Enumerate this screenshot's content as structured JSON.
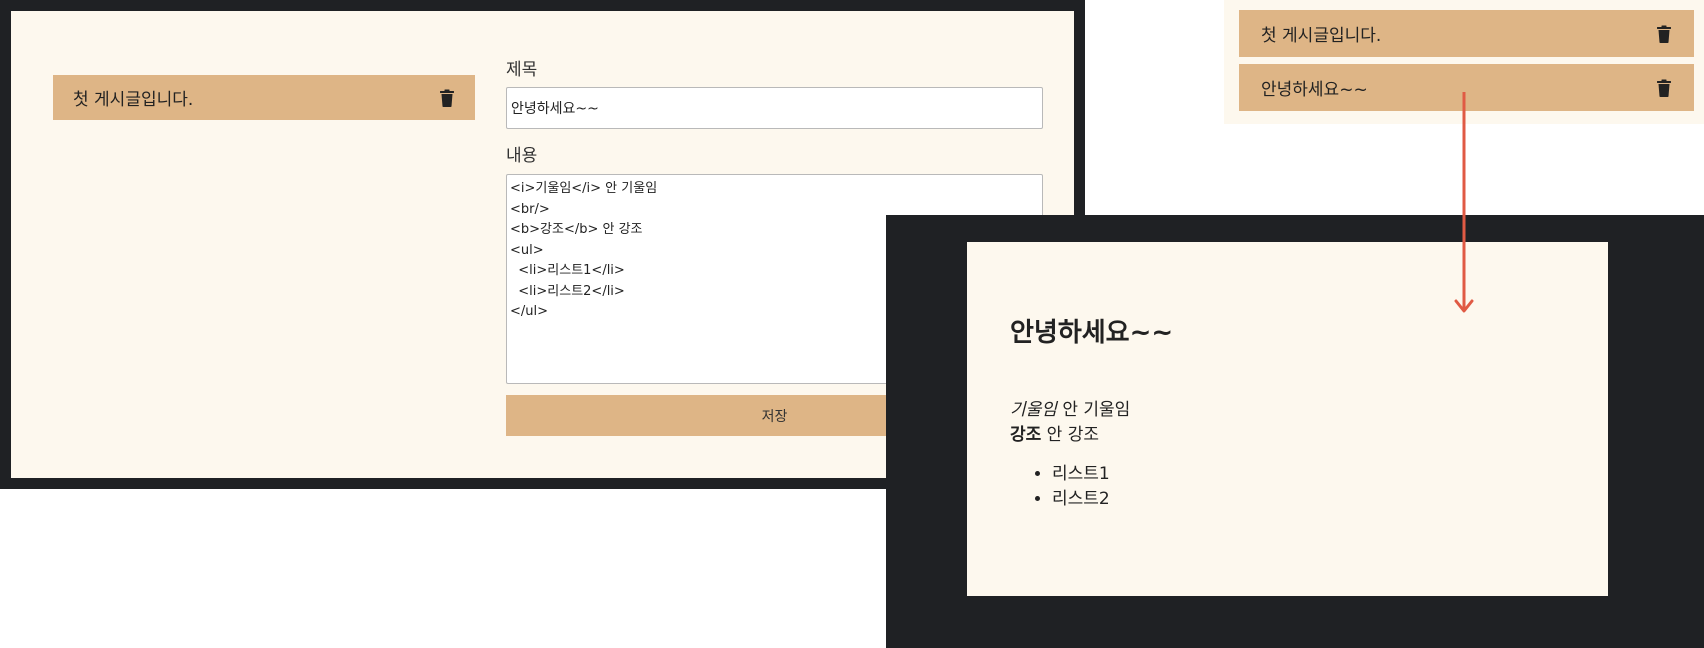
{
  "editor": {
    "post_list": [
      {
        "title": "첫 게시글입니다."
      }
    ],
    "title_label": "제목",
    "title_value": "안녕하세요~~",
    "content_label": "내용",
    "content_value": "<i>기울임</i> 안 기울임\n<br/>\n<b>강조</b> 안 강조\n<ul>\n  <li>리스트1</li>\n  <li>리스트2</li>\n</ul>",
    "save_label": "저장"
  },
  "list_panel": {
    "items": [
      {
        "title": "첫 게시글입니다."
      },
      {
        "title": "안녕하세요~~"
      }
    ]
  },
  "preview": {
    "title": "안녕하세요~~",
    "italic_text": "기울임",
    "normal_after_italic": " 안 기울임",
    "bold_text": "강조",
    "normal_after_bold": " 안 강조",
    "list_items": [
      "리스트1",
      "리스트2"
    ]
  },
  "colors": {
    "accent": "#deb586",
    "background": "#fdf8ee",
    "frame": "#1f2124",
    "arrow": "#e05a44"
  },
  "icons": {
    "delete": "trash-icon"
  }
}
